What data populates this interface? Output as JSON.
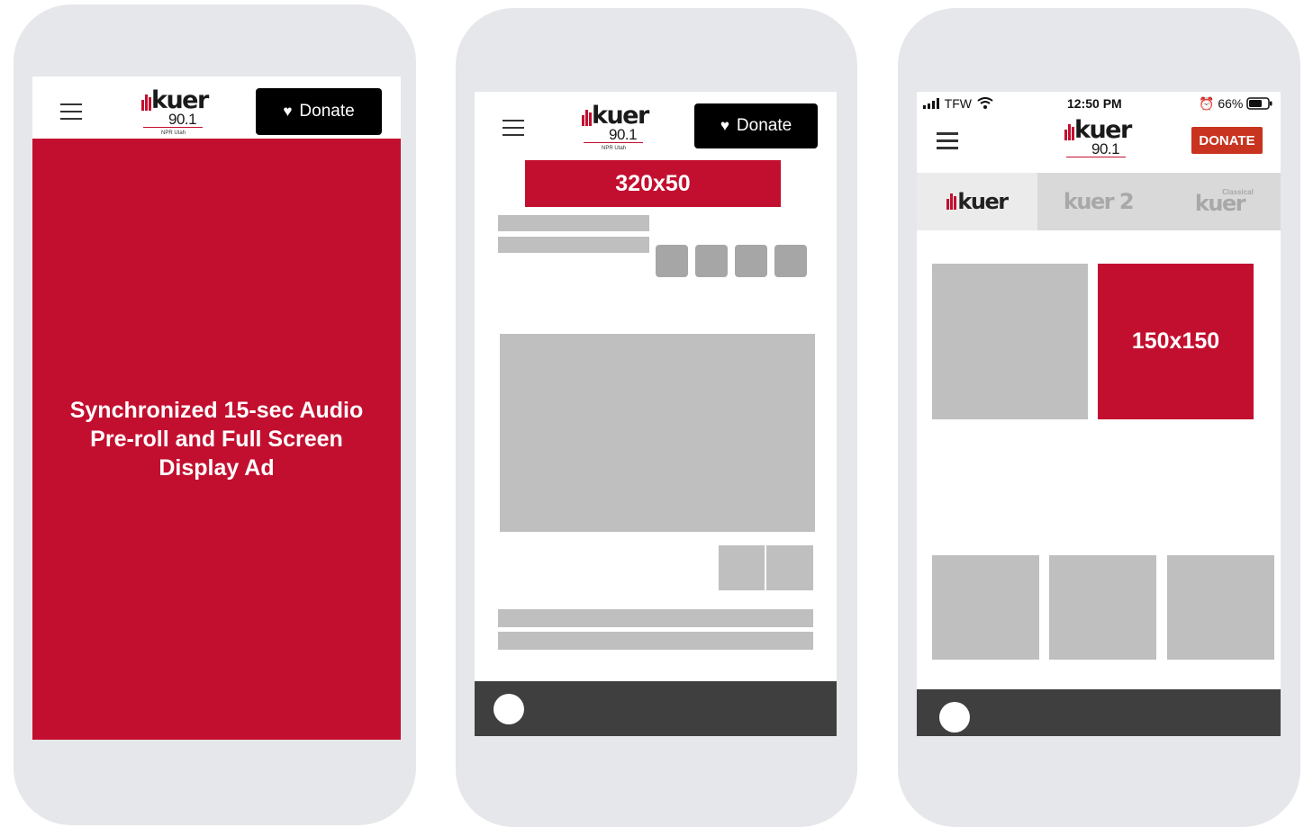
{
  "phone1": {
    "donate_label": "Donate",
    "ad_label": "Synchronized 15-sec Audio Pre-roll and Full Screen Display Ad"
  },
  "phone2": {
    "donate_label": "Donate",
    "banner_label": "320x50"
  },
  "phone3": {
    "status": {
      "carrier": "TFW",
      "time": "12:50 PM",
      "battery": "66%"
    },
    "donate_label": "DONATE",
    "tabs": [
      {
        "label": "kuer"
      },
      {
        "label": "kuer 2"
      },
      {
        "label": "kuer",
        "super": "Classical"
      }
    ],
    "ad_label": "150x150"
  },
  "logo": {
    "word": "kuer",
    "freq": "90.1",
    "tagline": "NPR Utah"
  },
  "colors": {
    "brand_red": "#c30f2f",
    "placeholder_gray": "#bfbfbf",
    "player_bar": "#3f3f3f",
    "phone_frame": "#e6e7ea"
  }
}
